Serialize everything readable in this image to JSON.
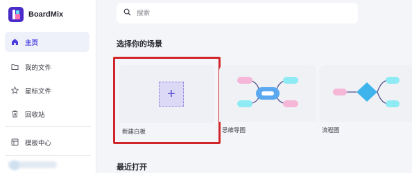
{
  "app": {
    "brand": "BoardMix"
  },
  "sidebar": {
    "items": [
      {
        "label": "主页",
        "icon": "home-icon",
        "active": true
      },
      {
        "label": "我的文件",
        "icon": "folder-icon"
      },
      {
        "label": "星标文件",
        "icon": "star-icon"
      },
      {
        "label": "回收站",
        "icon": "trash-icon"
      },
      {
        "label": "模板中心",
        "icon": "template-icon"
      }
    ]
  },
  "search": {
    "placeholder": "搜索",
    "value": ""
  },
  "main": {
    "scene_title": "选择你的场景",
    "recent_title": "最近打开",
    "cards": [
      {
        "label": "新建白板",
        "icon": "plus-icon"
      },
      {
        "label": "思维导图"
      },
      {
        "label": "流程图"
      }
    ]
  },
  "colors": {
    "accent": "#4a3ee0",
    "highlight_border": "#d0262a",
    "logo_bg": "#4b2cc8",
    "mind_pink": "#f6b6d8",
    "mind_cyan": "#8eeaf3",
    "mind_center": "#5aa8f0",
    "flow_diamond": "#3fb4ec"
  }
}
